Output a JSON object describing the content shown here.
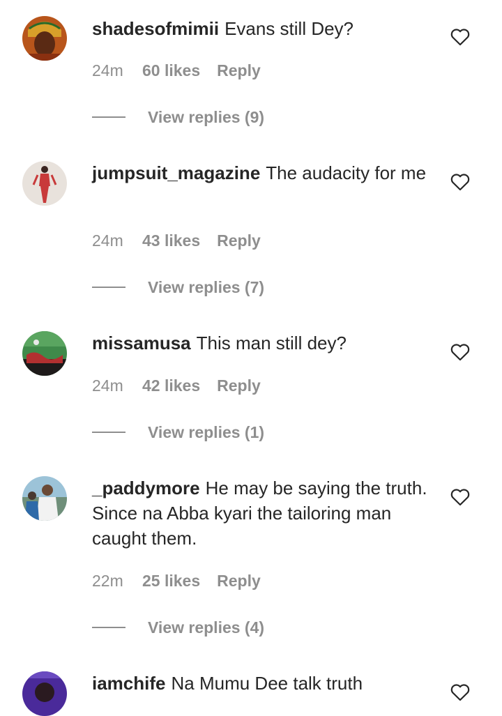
{
  "comments": [
    {
      "username": "shadesofmimii",
      "text": "Evans still Dey?",
      "time": "24m",
      "likes": "60 likes",
      "reply_label": "Reply",
      "view_replies": "View replies (9)"
    },
    {
      "username": "jumpsuit_magazine",
      "text": "The audacity for me",
      "time": "24m",
      "likes": "43 likes",
      "reply_label": "Reply",
      "view_replies": "View replies (7)"
    },
    {
      "username": "missamusa",
      "text": "This man still dey?",
      "time": "24m",
      "likes": "42 likes",
      "reply_label": "Reply",
      "view_replies": "View replies (1)"
    },
    {
      "username": "_paddymore",
      "text": "He may be saying the truth. Since na Abba kyari the tailoring man caught them.",
      "time": "22m",
      "likes": "25 likes",
      "reply_label": "Reply",
      "view_replies": "View replies (4)"
    },
    {
      "username": "iamchife",
      "text": "Na Mumu Dee talk truth"
    }
  ],
  "icons": {
    "like": "heart-outline-icon",
    "avatar": "profile-avatar"
  },
  "colors": {
    "text": "#262626",
    "secondary": "#8e8e8e",
    "background": "#ffffff"
  }
}
